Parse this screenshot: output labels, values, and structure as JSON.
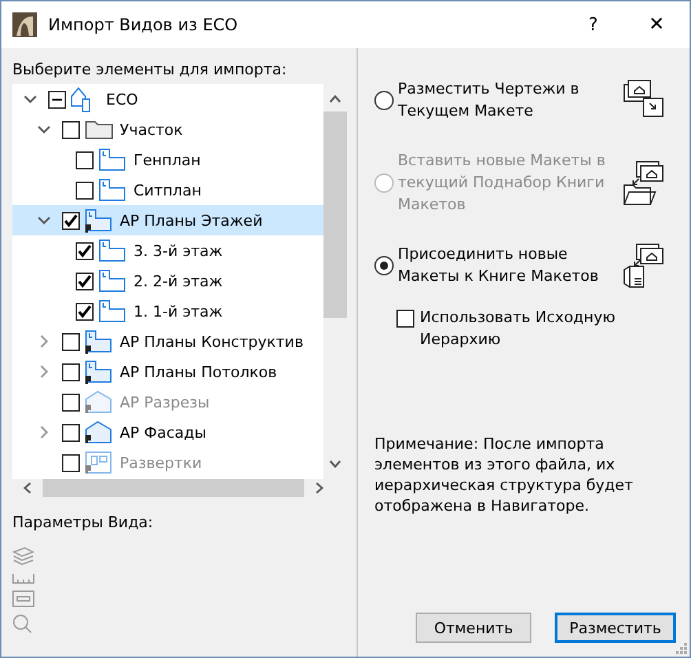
{
  "window": {
    "title": "Импорт Видов из ECO",
    "help": "?",
    "close": "✕"
  },
  "tree": {
    "label": "Выберите элементы для импорта:",
    "items": [
      {
        "label": "ECO",
        "kind": "project",
        "expanded": true,
        "checked": false,
        "partial": true,
        "disabled": false,
        "selected": false,
        "children": [
          {
            "label": "Участок",
            "kind": "folder",
            "expanded": true,
            "checked": false,
            "disabled": false,
            "selected": false,
            "children": [
              {
                "label": "Генплан",
                "kind": "plan",
                "checked": false,
                "disabled": false,
                "selected": false
              },
              {
                "label": "Ситплан",
                "kind": "plan",
                "checked": false,
                "disabled": false,
                "selected": false
              }
            ]
          },
          {
            "label": "АР Планы Этажей",
            "kind": "linked-plan",
            "expanded": true,
            "checked": true,
            "disabled": false,
            "selected": true,
            "children": [
              {
                "label": "3. 3-й этаж",
                "kind": "plan",
                "checked": true,
                "disabled": false,
                "selected": false
              },
              {
                "label": "2. 2-й этаж",
                "kind": "plan",
                "checked": true,
                "disabled": false,
                "selected": false
              },
              {
                "label": "1. 1-й этаж",
                "kind": "plan",
                "checked": true,
                "disabled": false,
                "selected": false
              }
            ]
          },
          {
            "label": "АР Планы Конструктив",
            "kind": "linked-plan",
            "expanded": false,
            "checked": false,
            "disabled": false,
            "selected": false
          },
          {
            "label": "АР Планы Потолков",
            "kind": "linked-plan",
            "expanded": false,
            "checked": false,
            "disabled": false,
            "selected": false
          },
          {
            "label": "АР Разрезы",
            "kind": "section",
            "checked": false,
            "disabled": true,
            "selected": false
          },
          {
            "label": "АР Фасады",
            "kind": "section",
            "expanded": false,
            "checked": false,
            "disabled": false,
            "selected": false
          },
          {
            "label": "Развертки",
            "kind": "interior",
            "checked": false,
            "disabled": true,
            "selected": false
          }
        ]
      }
    ]
  },
  "view_params": {
    "label": "Параметры Вида:"
  },
  "options": [
    {
      "label": "Разместить Чертежи в Текущем Макете",
      "kind": "place",
      "selected": false,
      "disabled": false
    },
    {
      "label": "Вставить новые Макеты в текущий Поднабор Книги Макетов",
      "kind": "insert",
      "selected": false,
      "disabled": true
    },
    {
      "label": "Присоединить новые Макеты к Книге Макетов",
      "kind": "append",
      "selected": true,
      "disabled": false
    }
  ],
  "hierarchy_checkbox": {
    "label": "Использовать Исходную Иерархию",
    "checked": false
  },
  "note": "Примечание: После импорта элементов из этого файла, их иерархическая структура будет отображена в Навигаторе.",
  "buttons": [
    {
      "label": "Отменить",
      "default": false
    },
    {
      "label": "Разместить",
      "default": true
    }
  ]
}
